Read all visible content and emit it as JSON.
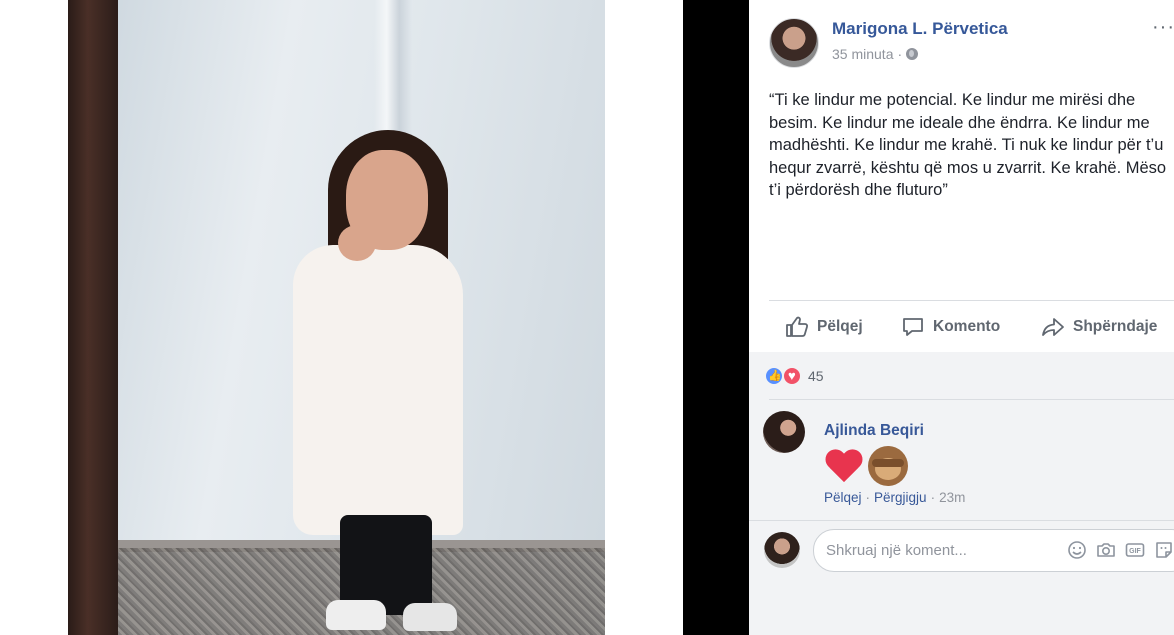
{
  "post": {
    "author": "Marigona L. Përvetica",
    "time": "35 minuta",
    "meta_separator": "·",
    "more": "···",
    "text": "“Ti ke lindur me potencial. Ke lindur me mirësi dhe besim. Ke lindur me ideale dhe ëndrra. Ke lindur me madhështi. Ke lindur me krahë. Ti nuk ke lindur për t’u hequr zvarrë, kështu që mos u zvarrit. Ke krahë. Mëso t’i përdorësh dhe fluturo”"
  },
  "actions": {
    "like": "Pëlqej",
    "comment": "Komento",
    "share": "Shpërndaje"
  },
  "reactions": {
    "count": "45",
    "types": [
      "like",
      "love"
    ]
  },
  "comment": {
    "author": "Ajlinda Beqiri",
    "emojis": [
      "heart-emoji",
      "see-no-evil-monkey-emoji"
    ],
    "like_label": "Pëlqej",
    "reply_label": "Përgjigju",
    "separator": "·",
    "time": "23m"
  },
  "composer": {
    "placeholder": "Shkruaj një koment...",
    "icons": [
      "emoji-icon",
      "camera-icon",
      "gif-icon",
      "sticker-icon"
    ]
  },
  "colors": {
    "link_blue": "#365899",
    "text": "#1d2129",
    "muted": "#90949c",
    "action": "#606770",
    "like_blue": "#5890ff",
    "love_red": "#f25268",
    "comments_bg": "#f2f3f5"
  }
}
